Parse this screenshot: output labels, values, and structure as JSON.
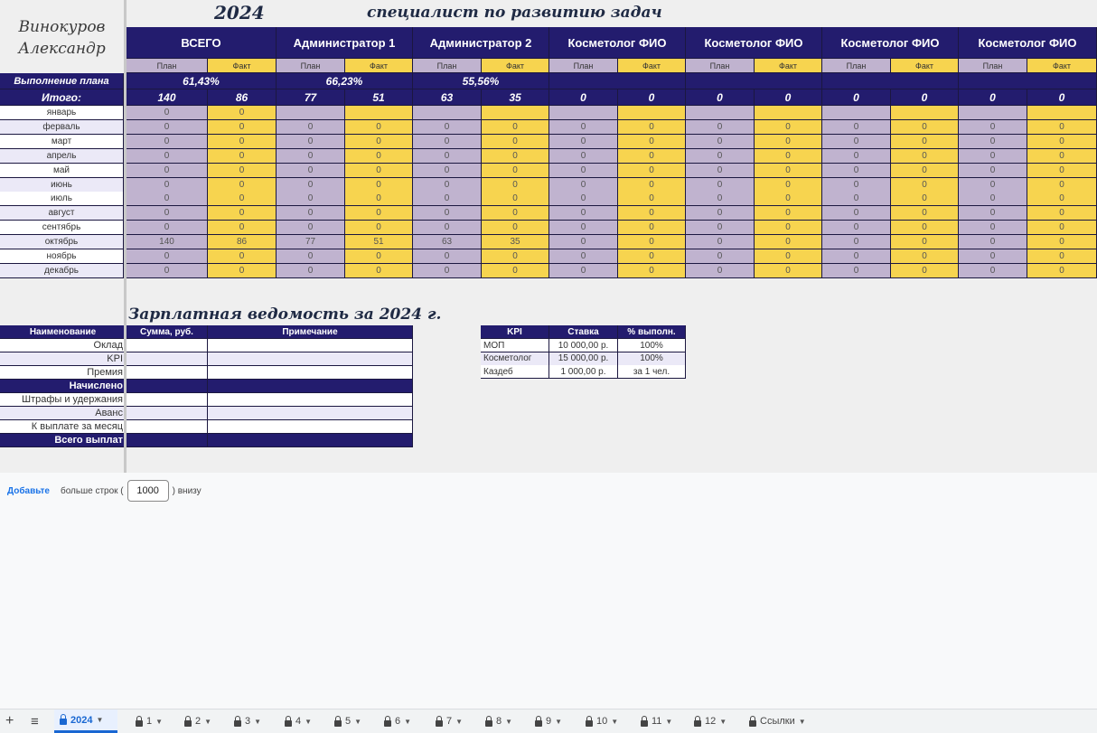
{
  "header": {
    "name_line1": "Винокуров",
    "name_line2": "Александр",
    "year": "2024",
    "role": "специалист по развитию задач"
  },
  "groups": [
    "ВСЕГО",
    "Администратор 1",
    "Администратор 2",
    "Косметолог ФИО",
    "Косметолог ФИО",
    "Косметолог ФИО",
    "Косметолог ФИО"
  ],
  "sub_plan": "План",
  "sub_fact": "Факт",
  "plan_row_label": "Выполнение плана",
  "plan_pct": [
    "61,43%",
    "66,23%",
    "55,56%",
    "",
    "",
    "",
    ""
  ],
  "total_row_label": "Итого:",
  "totals": [
    [
      "140",
      "86"
    ],
    [
      "77",
      "51"
    ],
    [
      "63",
      "35"
    ],
    [
      "0",
      "0"
    ],
    [
      "0",
      "0"
    ],
    [
      "0",
      "0"
    ],
    [
      "0",
      "0"
    ]
  ],
  "months": [
    {
      "name": "январь",
      "values": [
        "0",
        "0",
        "",
        "",
        "",
        "",
        "",
        "",
        "",
        "",
        "",
        "",
        "",
        ""
      ]
    },
    {
      "name": "ферваль",
      "values": [
        "0",
        "0",
        "0",
        "0",
        "0",
        "0",
        "0",
        "0",
        "0",
        "0",
        "0",
        "0",
        "0",
        "0"
      ]
    },
    {
      "name": "март",
      "values": [
        "0",
        "0",
        "0",
        "0",
        "0",
        "0",
        "0",
        "0",
        "0",
        "0",
        "0",
        "0",
        "0",
        "0"
      ]
    },
    {
      "name": "апрель",
      "values": [
        "0",
        "0",
        "0",
        "0",
        "0",
        "0",
        "0",
        "0",
        "0",
        "0",
        "0",
        "0",
        "0",
        "0"
      ]
    },
    {
      "name": "май",
      "values": [
        "0",
        "0",
        "0",
        "0",
        "0",
        "0",
        "0",
        "0",
        "0",
        "0",
        "0",
        "0",
        "0",
        "0"
      ]
    },
    {
      "name": "июнь",
      "values": [
        "0",
        "0",
        "0",
        "0",
        "0",
        "0",
        "0",
        "0",
        "0",
        "0",
        "0",
        "0",
        "0",
        "0"
      ]
    },
    {
      "name": "июль",
      "values": [
        "0",
        "0",
        "0",
        "0",
        "0",
        "0",
        "0",
        "0",
        "0",
        "0",
        "0",
        "0",
        "0",
        "0"
      ]
    },
    {
      "name": "август",
      "values": [
        "0",
        "0",
        "0",
        "0",
        "0",
        "0",
        "0",
        "0",
        "0",
        "0",
        "0",
        "0",
        "0",
        "0"
      ]
    },
    {
      "name": "сентябрь",
      "values": [
        "0",
        "0",
        "0",
        "0",
        "0",
        "0",
        "0",
        "0",
        "0",
        "0",
        "0",
        "0",
        "0",
        "0"
      ]
    },
    {
      "name": "октябрь",
      "values": [
        "140",
        "86",
        "77",
        "51",
        "63",
        "35",
        "0",
        "0",
        "0",
        "0",
        "0",
        "0",
        "0",
        "0"
      ]
    },
    {
      "name": "ноябрь",
      "values": [
        "0",
        "0",
        "0",
        "0",
        "0",
        "0",
        "0",
        "0",
        "0",
        "0",
        "0",
        "0",
        "0",
        "0"
      ]
    },
    {
      "name": "декабрь",
      "values": [
        "0",
        "0",
        "0",
        "0",
        "0",
        "0",
        "0",
        "0",
        "0",
        "0",
        "0",
        "0",
        "0",
        "0"
      ]
    }
  ],
  "salary": {
    "title": "Зарплатная ведомость за 2024 г.",
    "col_name": "Наименование",
    "col_sum": "Сумма, руб.",
    "col_note": "Примечание",
    "rows": [
      "Оклад",
      "KPI",
      "Премия",
      "Начислено",
      "Штрафы и удержания",
      "Аванс",
      "К выплате за месяц",
      "Всего выплат"
    ]
  },
  "kpi": {
    "col_kpi": "KPI",
    "col_rate": "Ставка",
    "col_pct": "% выполн.",
    "rows": [
      {
        "name": "МОП",
        "rate": "10 000,00 р.",
        "pct": "100%"
      },
      {
        "name": "Косметолог",
        "rate": "15 000,00 р.",
        "pct": "100%"
      },
      {
        "name": "Каздеб",
        "rate": "1 000,00 р.",
        "pct": "за 1 чел."
      }
    ]
  },
  "addrows": {
    "link": "Добавьте",
    "text1": "больше строк (",
    "value": "1000",
    "text2": ") внизу"
  },
  "tabs": {
    "add": "+",
    "menu": "≡",
    "items": [
      "2024",
      "1",
      "2",
      "3",
      "4",
      "5",
      "6",
      "7",
      "8",
      "9",
      "10",
      "11",
      "12",
      "Ссылки"
    ]
  }
}
